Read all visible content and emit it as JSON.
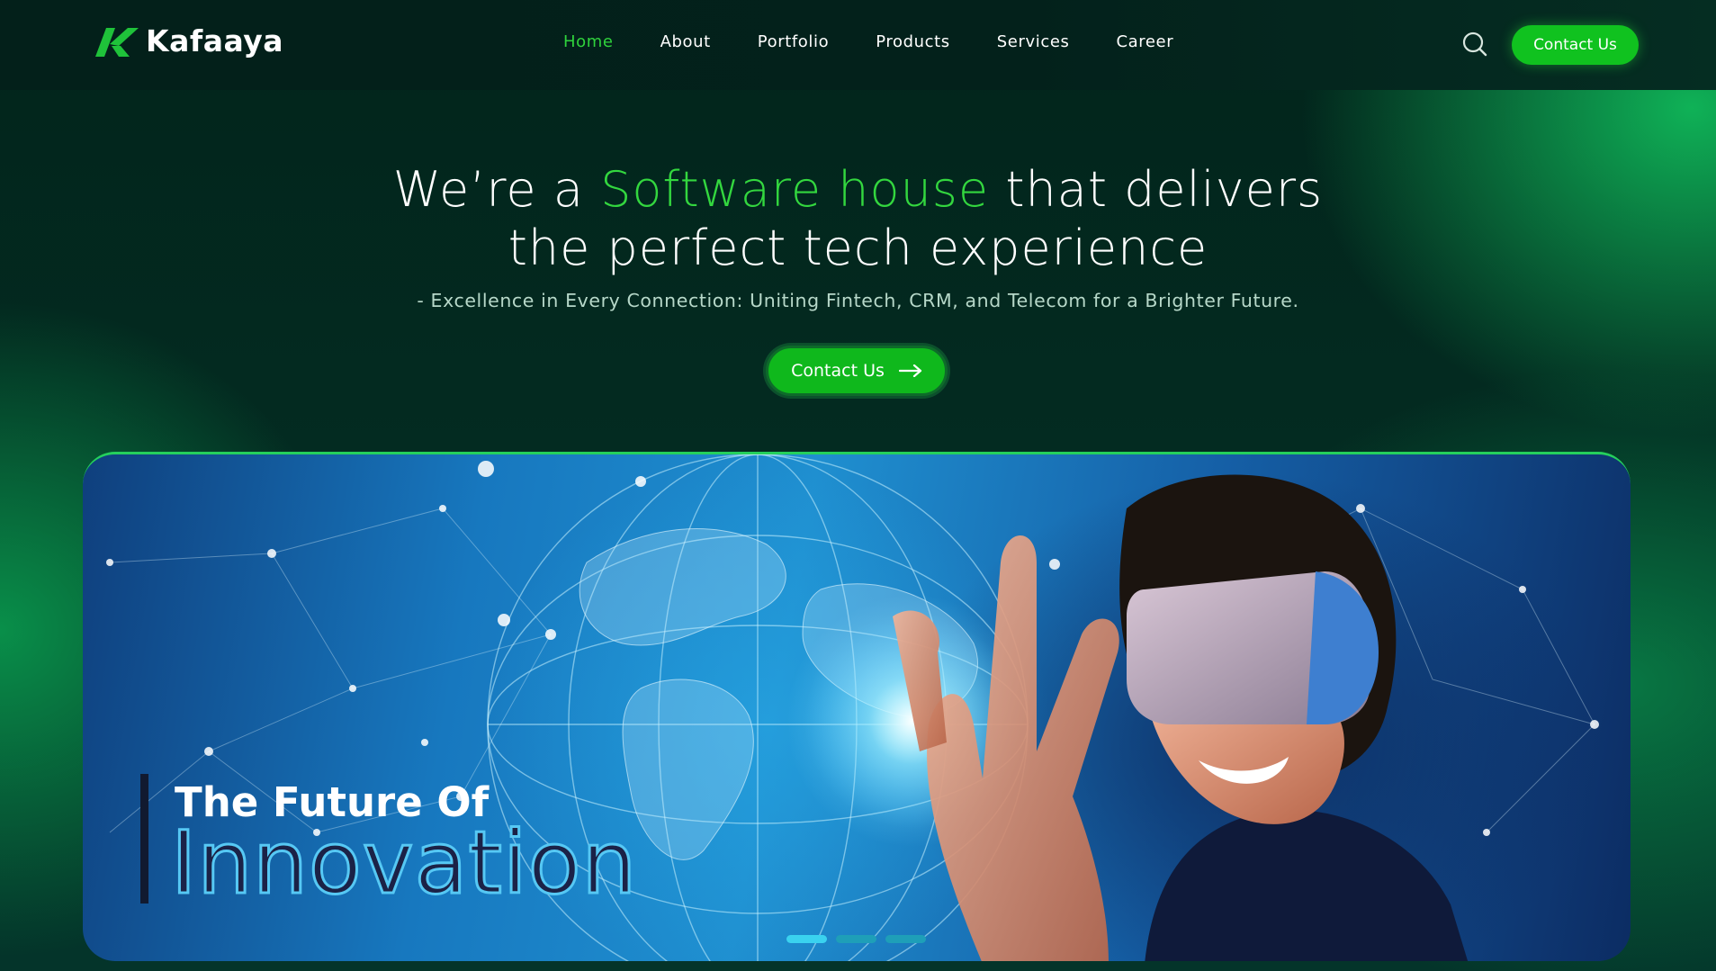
{
  "brand": {
    "name": "Kafaaya",
    "logo_icon": "k-logo-icon"
  },
  "nav": {
    "items": [
      {
        "label": "Home",
        "active": true
      },
      {
        "label": "About",
        "active": false
      },
      {
        "label": "Portfolio",
        "active": false
      },
      {
        "label": "Products",
        "active": false
      },
      {
        "label": "Services",
        "active": false
      },
      {
        "label": "Career",
        "active": false
      }
    ],
    "search_icon": "search-icon",
    "contact_label": "Contact Us"
  },
  "hero": {
    "title_prefix": "We’re a",
    "title_highlight": "Software house",
    "title_suffix": "that delivers",
    "title_line2": "the perfect tech experience",
    "subtitle": "- Excellence in Every Connection: Uniting Fintech, CRM, and Telecom for a Brighter Future.",
    "cta_label": "Contact Us",
    "cta_icon": "arrow-right-icon"
  },
  "banner": {
    "tagline_small": "The Future Of",
    "tagline_large": "Innovation",
    "slide_count": 3,
    "active_slide": 1
  },
  "colors": {
    "accent": "#2fd23c",
    "button": "#10c21f",
    "background": "#032a20"
  }
}
